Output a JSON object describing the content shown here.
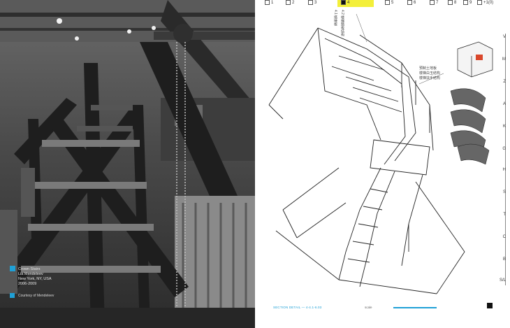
{
  "photo": {
    "caption_lines": [
      "Crown Stairs",
      "Lia Mendeleev",
      "New York, NY, USA",
      "2006-2009"
    ],
    "credit": "Courtesy of Mendeleev"
  },
  "drawing": {
    "tabs": [
      "1",
      "2",
      "3",
      "4",
      "5",
      "6",
      "7",
      "8",
      "9",
      "+1(0)"
    ],
    "active_tab": "4",
    "levels": [
      "V",
      "M",
      "Z",
      "A",
      "K",
      "G",
      "H",
      "S",
      "T",
      "C",
      "B",
      "S/L"
    ],
    "notes": {
      "left_stack": [
        "4.1 搭接板",
        "4.2 楼梯踏板结构"
      ],
      "right_label": [
        "预制土地板",
        "楼梯白玉结构",
        "楼梯扶手结构"
      ]
    },
    "section_label": "SECTION DETAIL — 4-4.1-6.03",
    "scale_label": "scale"
  }
}
